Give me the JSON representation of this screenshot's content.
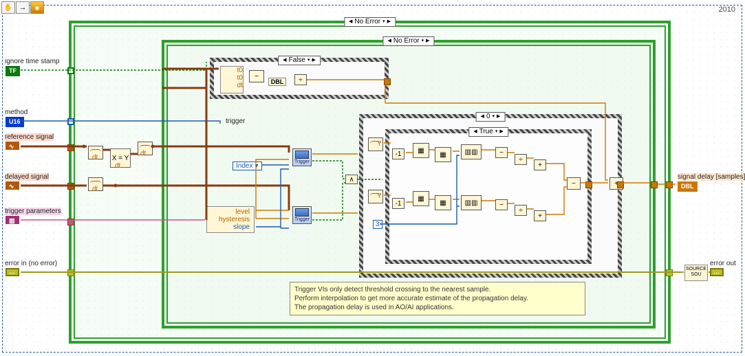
{
  "header": {
    "version": "2010"
  },
  "toolbar": {
    "hand": "hand-tool",
    "arrow": "arrow-tool",
    "break": "highlight-tool"
  },
  "structures": {
    "outer_case": {
      "selector": "No Error"
    },
    "mid_case": {
      "selector": "No Error"
    },
    "false_case": {
      "selector": "False"
    },
    "zero_case": {
      "selector": "0"
    },
    "true_case": {
      "selector": "True"
    }
  },
  "controls": {
    "ignore_time_stamp": {
      "label": "ignore time stamp",
      "type": "TF"
    },
    "method": {
      "label": "method",
      "type": "U16"
    },
    "reference_signal": {
      "label": "reference signal"
    },
    "delayed_signal": {
      "label": "delayed signal"
    },
    "trigger_parameters": {
      "label": "trigger parameters"
    },
    "error_in": {
      "label": "error in (no error)"
    }
  },
  "indicators": {
    "signal_delay": {
      "label": "signal delay [samples]",
      "type": "DBL"
    },
    "error_out": {
      "label": "error out"
    }
  },
  "rings": {
    "index": "Index"
  },
  "labels": {
    "trigger": "trigger",
    "level": "level",
    "hysteresis": "hysteresis",
    "slope": "slope",
    "eq": "X = Y",
    "dt": "dt",
    "t0": "t0",
    "dbl": "DBL",
    "trig_vi": "Trigger"
  },
  "constants": {
    "three": "3"
  },
  "note": {
    "l1": "Trigger VIs only detect threshold crossing to the nearest sample.",
    "l2": "Perform interpolation to get more accurate estimate of the propagation delay.",
    "l3": "The propagation delay is used in AO/AI applications."
  }
}
